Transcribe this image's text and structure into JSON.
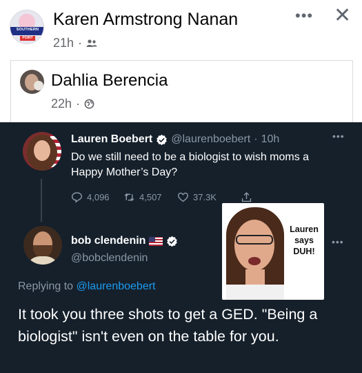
{
  "post": {
    "author": "Karen Armstrong Nanan",
    "time": "21h",
    "avatar_text": "SOUTHERN",
    "avatar_ribbon": "POINT",
    "more_icon": "more-horizontal-icon",
    "close_icon": "close-icon",
    "audience_icon": "friends-icon"
  },
  "shared_post": {
    "author": "Dahlia Berencia",
    "time": "22h",
    "audience_icon": "globe-icon"
  },
  "tweet": {
    "author_name": "Lauren Boebert",
    "author_handle": "@laurenboebert",
    "time": "10h",
    "text": "Do we still need to be a biologist to wish moms a Happy Mother’s Day?",
    "replies": "4,096",
    "retweets": "4,507",
    "likes": "37.3K"
  },
  "reply": {
    "author_name": "bob clendenin",
    "author_handle": "@bobclendenin",
    "replying_prefix": "Replying to",
    "replying_to": "@laurenboebert",
    "text": "It took you three shots to get a GED. \"Being a biologist\" isn't even on the table for you."
  },
  "meme": {
    "caption": "Lauren says DUH!"
  },
  "colors": {
    "tweet_bg": "#15202b",
    "link_blue": "#1d9bf0",
    "muted": "#8b98a5"
  }
}
